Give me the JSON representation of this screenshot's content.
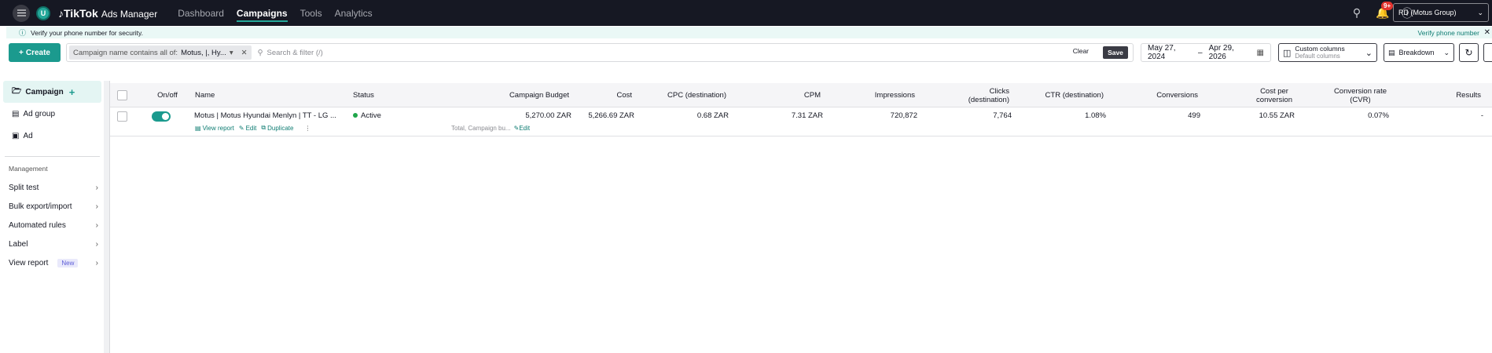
{
  "topbar": {
    "account_initial": "U",
    "brand": "TikTok",
    "brand_sub": "Ads Manager",
    "nav": [
      "Dashboard",
      "Campaigns",
      "Tools",
      "Analytics"
    ],
    "notification_count": "9+",
    "account_name": "RD (Motus Group)"
  },
  "banner": {
    "message": "Verify your phone number for security.",
    "link": "Verify phone number"
  },
  "toolbar": {
    "create_label": "Create",
    "filter_chip_prefix": "Campaign name contains all of:",
    "filter_chip_value": "Motus, |, Hy...",
    "search_placeholder": "Search & filter (/)",
    "clear_label": "Clear",
    "save_label": "Save",
    "date_start": "May 27, 2024",
    "date_sep": "–",
    "date_end": "Apr 29, 2026",
    "columns_label": "Custom columns",
    "columns_sub": "Default columns",
    "breakdown_label": "Breakdown"
  },
  "sidebar": {
    "levels": [
      "Campaign",
      "Ad group",
      "Ad"
    ],
    "section_title": "Management",
    "items": [
      "Split test",
      "Bulk export/import",
      "Automated rules",
      "Label",
      "View report"
    ],
    "new_badge": "New"
  },
  "table": {
    "headers": {
      "onoff": "On/off",
      "name": "Name",
      "status": "Status",
      "budget": "Campaign Budget",
      "cost": "Cost",
      "cpc": "CPC (destination)",
      "cpm": "CPM",
      "impressions": "Impressions",
      "clicks_1": "Clicks",
      "clicks_2": "(destination)",
      "ctr": "CTR (destination)",
      "conversions": "Conversions",
      "cpconv_1": "Cost per",
      "cpconv_2": "conversion",
      "cvr_1": "Conversion rate",
      "cvr_2": "(CVR)",
      "results": "Results"
    },
    "rows": [
      {
        "name": "Motus | Motus Hyundai Menlyn | TT - LG ...",
        "view_report": "View report",
        "edit": "Edit",
        "duplicate": "Duplicate",
        "status": "Active",
        "budget": "5,270.00 ZAR",
        "budget_sub": "Total, Campaign bu...",
        "budget_edit": "Edit",
        "cost": "5,266.69 ZAR",
        "cpc": "0.68 ZAR",
        "cpm": "7.31 ZAR",
        "impressions": "720,872",
        "clicks": "7,764",
        "ctr": "1.08%",
        "conversions": "499",
        "cost_per_conversion": "10.55 ZAR",
        "cvr": "0.07%",
        "results": "-"
      }
    ]
  },
  "colors": {
    "accent": "#1b9a8e",
    "topbar": "#161823",
    "active_status": "#1fa64a"
  }
}
